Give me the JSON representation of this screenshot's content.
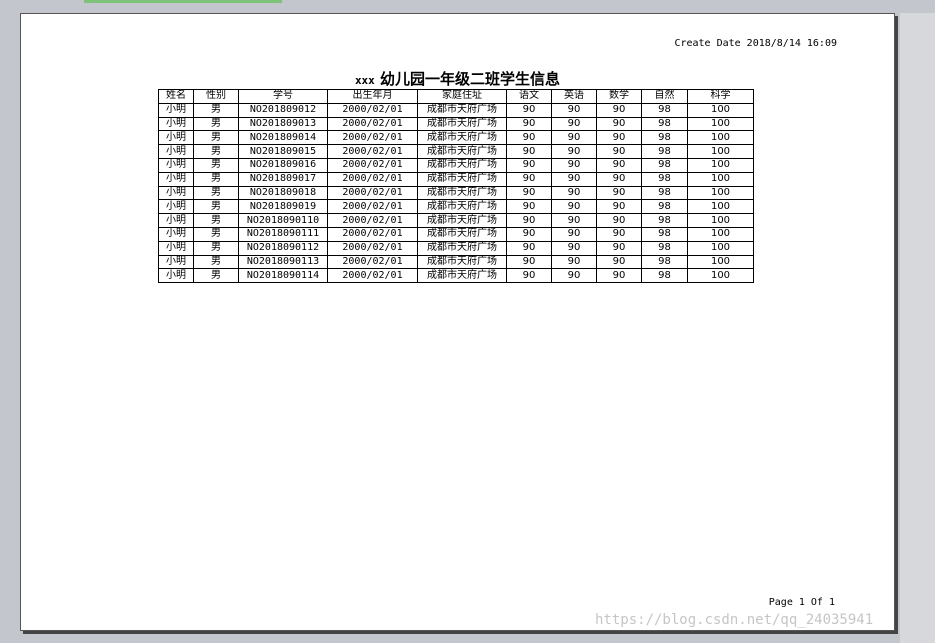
{
  "report": {
    "create_date": "Create Date 2018/8/14 16:09",
    "title_prefix": "xxx",
    "title_main": "幼儿园一年级二班学生信息",
    "page_label": "Page 1 Of 1"
  },
  "watermark": "https://blog.csdn.net/qq_24035941",
  "table": {
    "headers": [
      "姓名",
      "性别",
      "学号",
      "出生年月",
      "家庭住址",
      "语文",
      "英语",
      "数学",
      "自然",
      "科学"
    ],
    "rows": [
      [
        "小明",
        "男",
        "NO201809012",
        "2000/02/01",
        "成都市天府广场",
        "90",
        "90",
        "90",
        "98",
        "100"
      ],
      [
        "小明",
        "男",
        "NO201809013",
        "2000/02/01",
        "成都市天府广场",
        "90",
        "90",
        "90",
        "98",
        "100"
      ],
      [
        "小明",
        "男",
        "NO201809014",
        "2000/02/01",
        "成都市天府广场",
        "90",
        "90",
        "90",
        "98",
        "100"
      ],
      [
        "小明",
        "男",
        "NO201809015",
        "2000/02/01",
        "成都市天府广场",
        "90",
        "90",
        "90",
        "98",
        "100"
      ],
      [
        "小明",
        "男",
        "NO201809016",
        "2000/02/01",
        "成都市天府广场",
        "90",
        "90",
        "90",
        "98",
        "100"
      ],
      [
        "小明",
        "男",
        "NO201809017",
        "2000/02/01",
        "成都市天府广场",
        "90",
        "90",
        "90",
        "98",
        "100"
      ],
      [
        "小明",
        "男",
        "NO201809018",
        "2000/02/01",
        "成都市天府广场",
        "90",
        "90",
        "90",
        "98",
        "100"
      ],
      [
        "小明",
        "男",
        "NO201809019",
        "2000/02/01",
        "成都市天府广场",
        "90",
        "90",
        "90",
        "98",
        "100"
      ],
      [
        "小明",
        "男",
        "NO2018090110",
        "2000/02/01",
        "成都市天府广场",
        "90",
        "90",
        "90",
        "98",
        "100"
      ],
      [
        "小明",
        "男",
        "NO2018090111",
        "2000/02/01",
        "成都市天府广场",
        "90",
        "90",
        "90",
        "98",
        "100"
      ],
      [
        "小明",
        "男",
        "NO2018090112",
        "2000/02/01",
        "成都市天府广场",
        "90",
        "90",
        "90",
        "98",
        "100"
      ],
      [
        "小明",
        "男",
        "NO2018090113",
        "2000/02/01",
        "成都市天府广场",
        "90",
        "90",
        "90",
        "98",
        "100"
      ],
      [
        "小明",
        "男",
        "NO2018090114",
        "2000/02/01",
        "成都市天府广场",
        "90",
        "90",
        "90",
        "98",
        "100"
      ]
    ]
  }
}
